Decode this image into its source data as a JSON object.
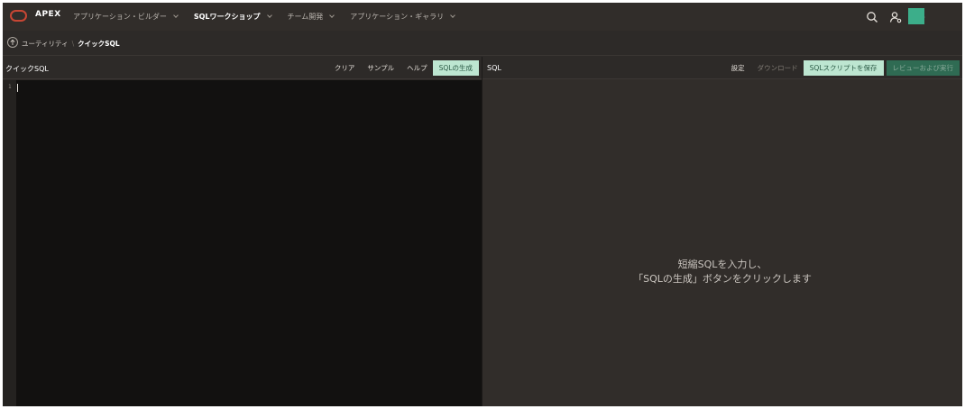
{
  "app": {
    "brand": "APEX",
    "brand_color": "#c74634",
    "nav": [
      {
        "label": "アプリケーション・ビルダー",
        "active": false
      },
      {
        "label": "SQLワークショップ",
        "active": true
      },
      {
        "label": "チーム開発",
        "active": false
      },
      {
        "label": "アプリケーション・ギャラリ",
        "active": false
      }
    ],
    "icons": [
      "search-icon",
      "user-settings-icon",
      "help-icon"
    ],
    "avatar_color": "#3cae8a"
  },
  "breadcrumb": {
    "parent": "ユーティリティ",
    "current": "クイックSQL"
  },
  "left_panel": {
    "title": "クイックSQL",
    "buttons": {
      "clear": "クリア",
      "sample": "サンプル",
      "help": "ヘルプ",
      "generate": "SQLの生成"
    },
    "editor": {
      "line_number": "1",
      "content": ""
    }
  },
  "right_panel": {
    "title": "SQL",
    "buttons": {
      "settings": "設定",
      "download": "ダウンロード",
      "save_script": "SQLスクリプトを保存",
      "review_run": "レビューおよび実行"
    },
    "placeholder_line1": "短縮SQLを入力し、",
    "placeholder_line2": "「SQLの生成」ボタンをクリックします"
  },
  "colors": {
    "accent_primary": "#bde6d1",
    "accent_run": "#2f6b53"
  }
}
